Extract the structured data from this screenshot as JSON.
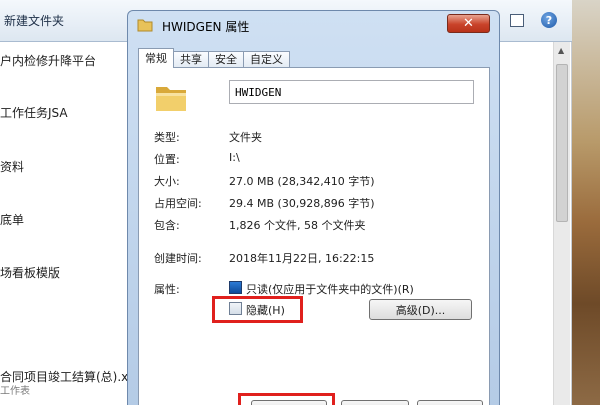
{
  "explorer": {
    "new_folder": "新建文件夹",
    "files": [
      {
        "label": "户内检修升降平台"
      },
      {
        "label": "工作任务JSA"
      },
      {
        "label": "资料"
      },
      {
        "label": "底单"
      },
      {
        "label": "场看板模版"
      },
      {
        "label": "合同项目竣工结算(总).xls",
        "sub": "工作表"
      }
    ]
  },
  "dialog": {
    "title": "HWIDGEN 属性",
    "tabs": [
      "常规",
      "共享",
      "安全",
      "自定义"
    ],
    "name_value": "HWIDGEN",
    "rows": [
      {
        "label": "类型:",
        "value": "文件夹"
      },
      {
        "label": "位置:",
        "value": "I:\\"
      },
      {
        "label": "大小:",
        "value": "27.0 MB (28,342,410 字节)"
      },
      {
        "label": "占用空间:",
        "value": "29.4 MB (30,928,896 字节)"
      },
      {
        "label": "包含:",
        "value": "1,826 个文件, 58 个文件夹"
      },
      {
        "label": "创建时间:",
        "value": "2018年11月22日, 16:22:15"
      }
    ],
    "attributes_label": "属性:",
    "readonly_label": "只读(仅应用于文件夹中的文件)(R)",
    "readonly_state": "partial",
    "hidden_label": "隐藏(H)",
    "hidden_checked": false,
    "advanced_button": "高级(D)..."
  },
  "colors": {
    "highlight": "#e0201d",
    "close_button": "#c9432a",
    "dialog_frame": "#b4cbe6"
  }
}
